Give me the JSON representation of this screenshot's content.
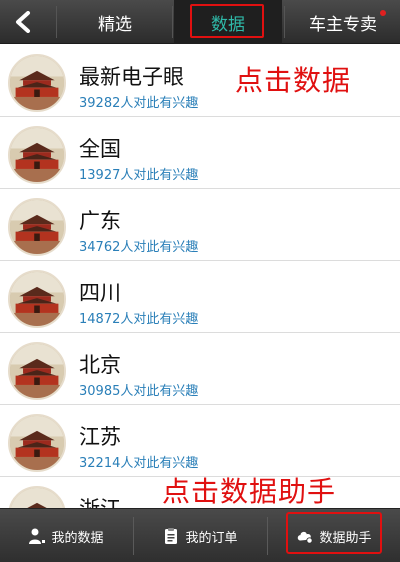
{
  "header": {
    "back_icon": "chevron-left-icon",
    "tabs": [
      {
        "label": "精选"
      },
      {
        "label": "数据"
      },
      {
        "label": "车主专卖"
      }
    ],
    "selected_tab_color": "#2fb9a8",
    "badge_color": "#e02020"
  },
  "list": {
    "items": [
      {
        "title": "最新电子眼",
        "subtitle": "39282人对此有兴趣"
      },
      {
        "title": "全国",
        "subtitle": "13927人对此有兴趣"
      },
      {
        "title": "广东",
        "subtitle": "34762人对此有兴趣"
      },
      {
        "title": "四川",
        "subtitle": "14872人对此有兴趣"
      },
      {
        "title": "北京",
        "subtitle": "30985人对此有兴趣"
      },
      {
        "title": "江苏",
        "subtitle": "32214人对此有兴趣"
      },
      {
        "title": "浙江",
        "subtitle": ""
      }
    ]
  },
  "annotations": {
    "top_note": "点击数据",
    "bottom_note": "点击数据助手"
  },
  "footer": {
    "buttons": [
      {
        "label": "我的数据",
        "icon": "user-icon"
      },
      {
        "label": "我的订单",
        "icon": "clipboard-icon"
      },
      {
        "label": "数据助手",
        "icon": "cloud-icon"
      }
    ]
  }
}
